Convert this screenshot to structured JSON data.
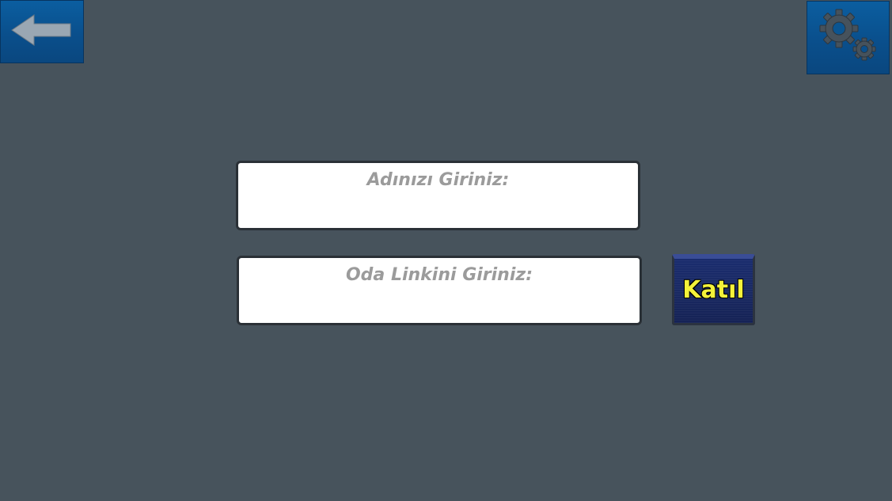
{
  "toolbar": {
    "back_icon": "back-arrow-icon",
    "settings_icon": "gear-icon"
  },
  "form": {
    "name_field": {
      "placeholder": "Adınızı Giriniz:",
      "value": ""
    },
    "link_field": {
      "placeholder": "Oda Linkini Giriniz:",
      "value": ""
    },
    "join_button": {
      "label": "Katıl"
    }
  },
  "colors": {
    "background": "#47535c",
    "toolbar_button": "#0b5ea0",
    "join_button": "#1a2a63",
    "join_label": "#f4f23a",
    "placeholder_text": "#9b9b9b"
  }
}
